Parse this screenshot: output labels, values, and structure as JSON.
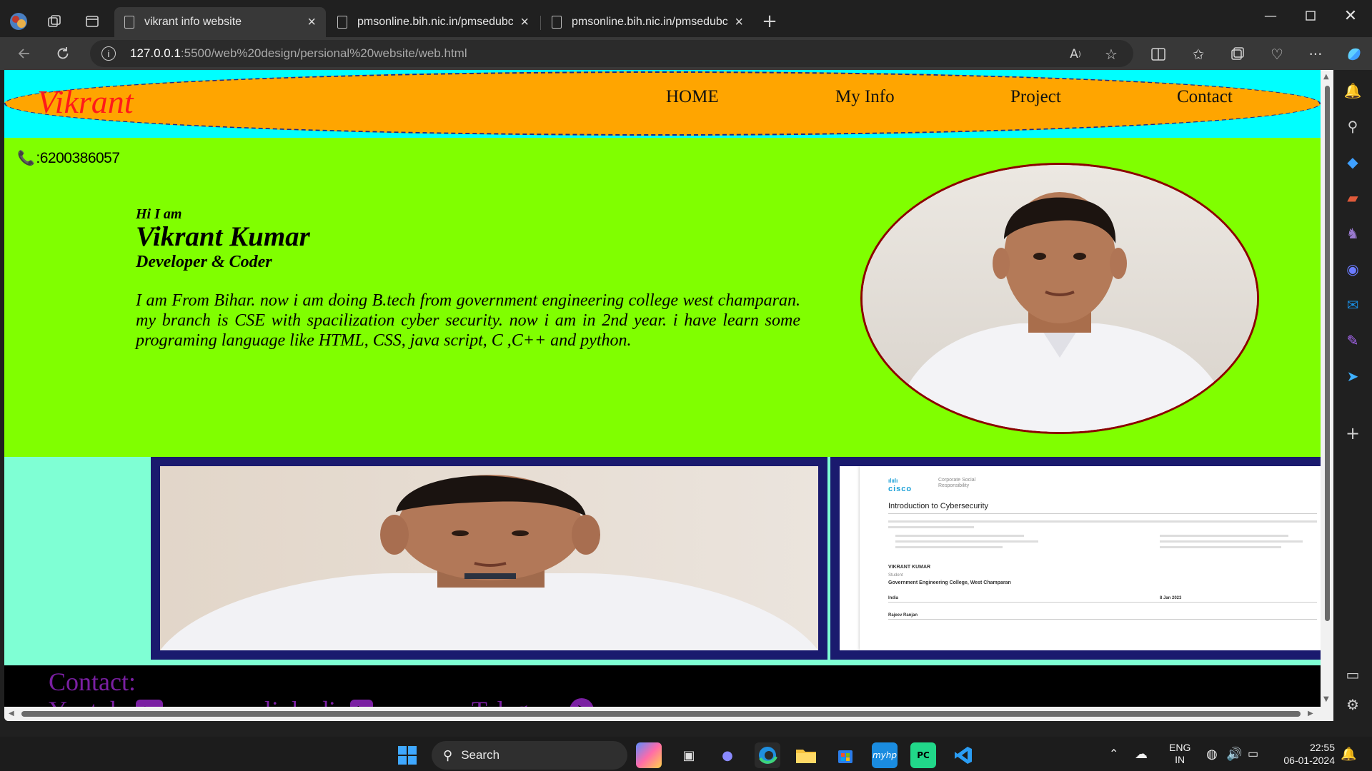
{
  "browser": {
    "tabs": [
      {
        "label": "vikrant info website",
        "active": true
      },
      {
        "label": "pmsonline.bih.nic.in/pmsedubcel",
        "active": false
      },
      {
        "label": "pmsonline.bih.nic.in/pmsedubcel",
        "active": false
      }
    ],
    "url": {
      "host": "127.0.0.1",
      "rest": ":5500/web%20design/persional%20website/web.html"
    },
    "icons": [
      "profile-icon",
      "workspaces-icon",
      "tab-actions-icon",
      "back-icon",
      "refresh-icon",
      "read-aloud-icon",
      "favorite-star-icon",
      "split-screen-icon",
      "favorites-icon",
      "collections-icon",
      "browser-essentials-icon",
      "more-icon",
      "copilot-icon"
    ]
  },
  "site": {
    "logo": "Vikrant",
    "nav": [
      "HOME",
      "My Info",
      "Project",
      "Contact"
    ],
    "phone": ":6200386057",
    "greeting": "Hi I am",
    "name": "Vikrant Kumar",
    "role": "Developer & Coder",
    "bio": "I am From Bihar. now i am doing B.tech from government engineering college west champaran. my branch is CSE with spacilization cyber security. now i am in 2nd year. i have learn some programing language like HTML, CSS, java script, C ,C++ and python.",
    "contact_title": "Contact:",
    "social": [
      "Youtube",
      "linkedin",
      "Telegram"
    ],
    "certificate": {
      "org": "cisco",
      "org_sub": "Corporate Social Responsibility",
      "title": "Introduction to Cybersecurity",
      "name": "VIKRANT KUMAR",
      "role": "Student",
      "institution": "Government Engineering College, West Champaran",
      "country": "India",
      "date": "8 Jan 2023",
      "instructor": "Rajeev Ranjan"
    }
  },
  "colors": {
    "header_bg": "#00ffff",
    "nav_ellipse": "#ffa500",
    "logo": "#ff1a1a",
    "hero_bg": "#80ff00",
    "gallery_bg": "#7fffd4",
    "frame_border": "#1a1a6e",
    "contact_text": "#7a1fa2"
  },
  "taskbar": {
    "search_placeholder": "Search",
    "lang": "ENG",
    "region": "IN",
    "time": "22:55",
    "date": "06-01-2024"
  }
}
